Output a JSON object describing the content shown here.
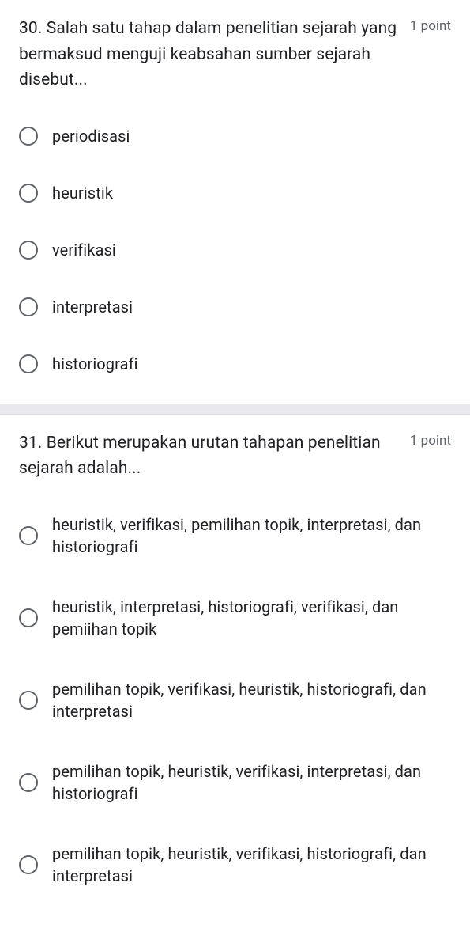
{
  "questions": [
    {
      "text": "30. Salah satu tahap dalam penelitian sejarah yang bermaksud menguji keabsahan sumber sejarah disebut...",
      "points": "1 point",
      "options": [
        "periodisasi",
        "heuristik",
        "verifikasi",
        "interpretasi",
        "historiografi"
      ]
    },
    {
      "text": "31. Berikut merupakan urutan tahapan penelitian sejarah adalah...",
      "points": "1 point",
      "options": [
        "heuristik, verifikasi, pemilihan topik, interpretasi, dan historiografi",
        "heuristik, interpretasi, historiografi, verifikasi, dan pemiihan topik",
        "pemilihan topik, verifikasi, heuristik, historiografi, dan interpretasi",
        "pemilihan topik, heuristik, verifikasi, interpretasi, dan historiografi",
        "pemilihan topik, heuristik, verifikasi, historiografi, dan interpretasi"
      ]
    }
  ]
}
